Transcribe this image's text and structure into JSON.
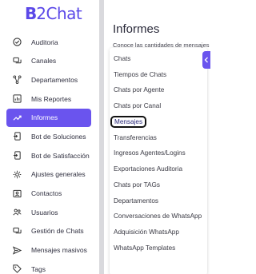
{
  "brand": {
    "logo_b": "B",
    "logo_text": "2Chat"
  },
  "sidebar": {
    "items": [
      {
        "label": "Auditoria",
        "icon": "check-circle-icon"
      },
      {
        "label": "Canales",
        "icon": "chat-bubbles-icon"
      },
      {
        "label": "Departamentos",
        "icon": "branch-icon"
      },
      {
        "label": "Mis Reportes",
        "icon": "report-icon"
      },
      {
        "label": "Informes",
        "icon": "trend-line-icon",
        "active": true
      },
      {
        "label": "Bot de Soluciones",
        "icon": "bot-door-icon"
      },
      {
        "label": "Bot de Satisfacción",
        "icon": "bot-door-icon"
      },
      {
        "label": "Ajustes generales",
        "icon": "gear-icon"
      },
      {
        "label": "Contactos",
        "icon": "contact-card-icon"
      },
      {
        "label": "Usuarios",
        "icon": "users-icon"
      },
      {
        "label": "Gestión de Chats",
        "icon": "chat-manage-icon"
      },
      {
        "label": "Mensajes masivos",
        "icon": "send-icon"
      },
      {
        "label": "Tags",
        "icon": "tag-icon"
      }
    ],
    "accent": "#6a54ee"
  },
  "main": {
    "title": "Informes",
    "subtitle": "Conoce las cantidades de mensajes"
  },
  "dropdown": {
    "items": [
      "Chats",
      "Tiempos de Chats",
      "Chats por Agente",
      "Chats por Canal",
      "Mensajes",
      "Transferencias",
      "Ingresos Agentes/Logins",
      "Exportaciones Auditoria",
      "Chats por TAGs",
      "Departamentos",
      "Conversaciones de WhatsApp",
      "Adquisición WhatsApp",
      "WhatsApp Templates"
    ],
    "highlighted": "Mensajes"
  }
}
